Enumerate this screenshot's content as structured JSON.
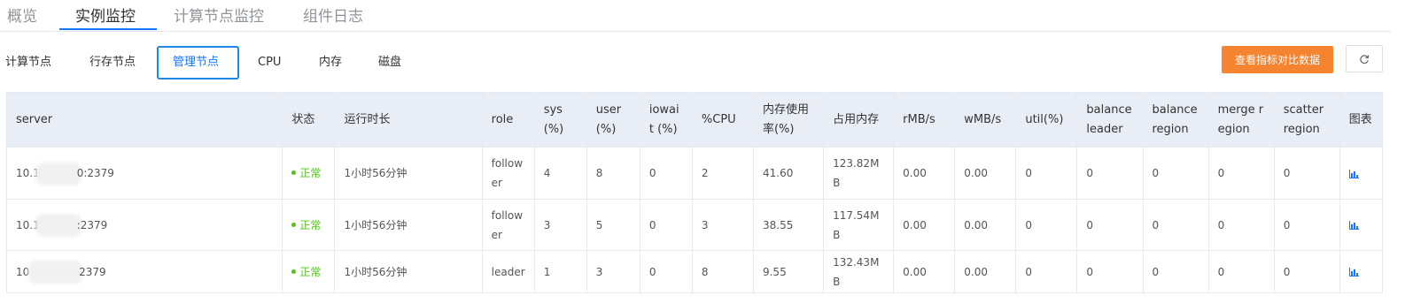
{
  "top_tabs": [
    {
      "label": "概览"
    },
    {
      "label": "实例监控"
    },
    {
      "label": "计算节点监控"
    },
    {
      "label": "组件日志"
    }
  ],
  "sub_tabs": [
    {
      "label": "计算节点"
    },
    {
      "label": "行存节点"
    },
    {
      "label": "管理节点"
    },
    {
      "label": "CPU"
    },
    {
      "label": "内存"
    },
    {
      "label": "磁盘"
    }
  ],
  "actions": {
    "compare_label": "查看指标对比数据",
    "accent": "#f58430",
    "active_blue": "#1677ff"
  },
  "table": {
    "headers": [
      "server",
      "状态",
      "运行时长",
      "role",
      "sys (%)",
      "user (%)",
      "iowait (%)",
      "%CPU",
      "内存使用率(%)",
      "占用内存",
      "rMB/s",
      "wMB/s",
      "util(%)",
      "balance leader",
      "balance region",
      "merge region",
      "scatter region",
      "图表"
    ],
    "rows": [
      {
        "server_prefix": "10.1",
        "server_suffix": "0:2379",
        "status": "正常",
        "uptime": "1小时56分钟",
        "role": "follower",
        "sys": "4",
        "user": "8",
        "iowait": "0",
        "cpu": "2",
        "mem_pct": "41.60",
        "mem": "123.82MB",
        "rmb": "0.00",
        "wmb": "0.00",
        "util": "0",
        "balance_leader": "0",
        "balance_region": "0",
        "merge_region": "0",
        "scatter_region": "0"
      },
      {
        "server_prefix": "10.1",
        "server_suffix": ":2379",
        "status": "正常",
        "uptime": "1小时56分钟",
        "role": "follower",
        "sys": "3",
        "user": "5",
        "iowait": "0",
        "cpu": "3",
        "mem_pct": "38.55",
        "mem": "117.54MB",
        "rmb": "0.00",
        "wmb": "0.00",
        "util": "0",
        "balance_leader": "0",
        "balance_region": "0",
        "merge_region": "0",
        "scatter_region": "0"
      },
      {
        "server_prefix": "10.",
        "server_suffix": "2379",
        "status": "正常",
        "uptime": "1小时56分钟",
        "role": "leader",
        "sys": "1",
        "user": "3",
        "iowait": "0",
        "cpu": "8",
        "mem_pct": "9.55",
        "mem": "132.43MB",
        "rmb": "0.00",
        "wmb": "0.00",
        "util": "0",
        "balance_leader": "0",
        "balance_region": "0",
        "merge_region": "0",
        "scatter_region": "0"
      }
    ],
    "status_color": "#52c41a",
    "chart_icon": "bar-chart-icon"
  }
}
